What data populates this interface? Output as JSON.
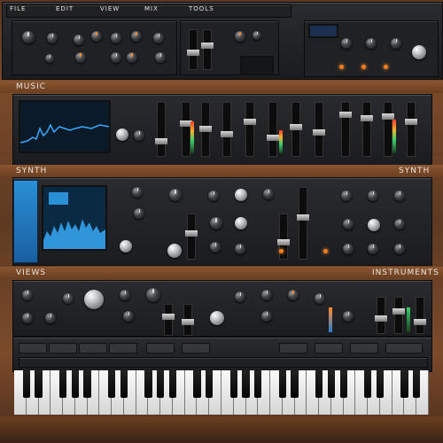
{
  "app": {
    "section_music_label": "MUSIC",
    "section_synth_label": "SYNTH",
    "section_synth_right_label": "SYNTH",
    "section_views_label": "VIEWS",
    "section_instruments_label": "INSTRUMENTS"
  },
  "top_bar": {
    "menu_items": [
      "FILE",
      "EDIT",
      "VIEW",
      "MIX",
      "TOOLS"
    ]
  },
  "colors": {
    "accent_orange": "#ff8a2a",
    "accent_blue": "#2a8fd4",
    "wood": "#7a4a2a",
    "panel": "#1f2023"
  },
  "icons": [
    "knob-icon",
    "fader-icon",
    "led-icon",
    "waveform-display-icon",
    "piano-keyboard-icon"
  ]
}
